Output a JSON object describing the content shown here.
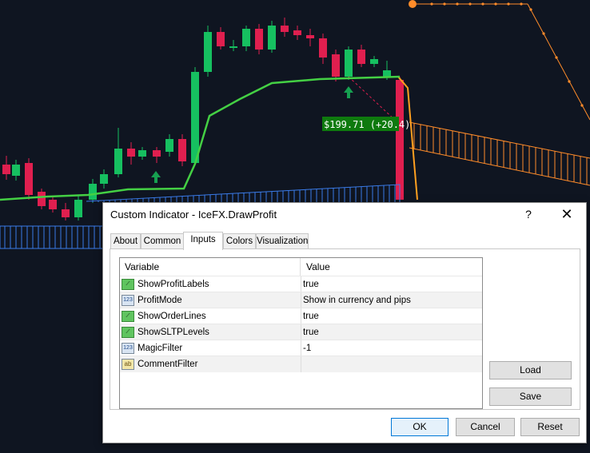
{
  "chart": {
    "price_label": "$199.71 (+20.4)",
    "colors": {
      "bull": "#16c060",
      "bear": "#e01f4f",
      "ma": "#44d044",
      "orange": "#ff8c2a",
      "blue": "#3a7be8",
      "label_bg": "#0e7a0e"
    }
  },
  "dialog": {
    "title": "Custom Indicator - IceFX.DrawProfit",
    "help": "?",
    "close": "✕",
    "tabs": [
      "About",
      "Common",
      "Inputs",
      "Colors",
      "Visualization"
    ],
    "active_tab": "Inputs",
    "grid": {
      "col_variable": "Variable",
      "col_value": "Value",
      "rows": [
        {
          "icon": "bool",
          "name": "ShowProfitLabels",
          "value": "true"
        },
        {
          "icon": "123",
          "name": "ProfitMode",
          "value": "Show in currency and pips"
        },
        {
          "icon": "bool",
          "name": "ShowOrderLines",
          "value": "true"
        },
        {
          "icon": "bool",
          "name": "ShowSLTPLevels",
          "value": "true"
        },
        {
          "icon": "123",
          "name": "MagicFilter",
          "value": "-1"
        },
        {
          "icon": "ab",
          "name": "CommentFilter",
          "value": ""
        }
      ]
    },
    "buttons": {
      "load": "Load",
      "save": "Save",
      "ok": "OK",
      "cancel": "Cancel",
      "reset": "Reset"
    }
  }
}
